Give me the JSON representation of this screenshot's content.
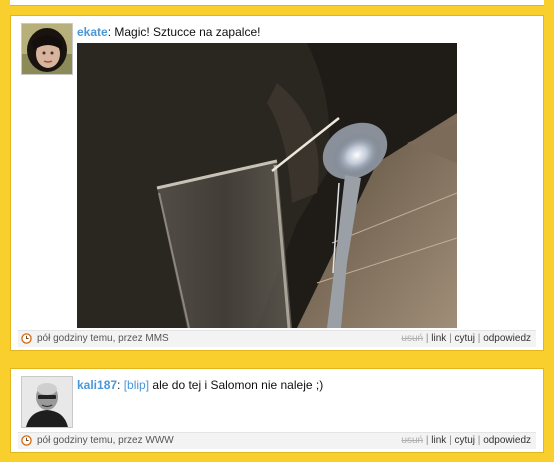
{
  "posts": [
    {
      "author": "ekate",
      "message": "Magic! Sztucce na zapalce!",
      "has_photo": true,
      "time": "pół godziny temu, przez MMS",
      "actions": {
        "delete": "usuń",
        "link": "link",
        "quote": "cytuj",
        "reply": "odpowiedz"
      }
    },
    {
      "author": "kali187",
      "tag": "[blip]",
      "message": "ale do tej i Salomon nie naleje ;)",
      "time": "pół godziny temu, przez WWW",
      "actions": {
        "delete": "usuń",
        "link": "link",
        "quote": "cytuj",
        "reply": "odpowiedz"
      }
    }
  ],
  "colors": {
    "background": "#f9cf2e",
    "author_link": "#4a97d9",
    "card": "#ffffff"
  },
  "icons": {
    "time": "clock-icon"
  }
}
